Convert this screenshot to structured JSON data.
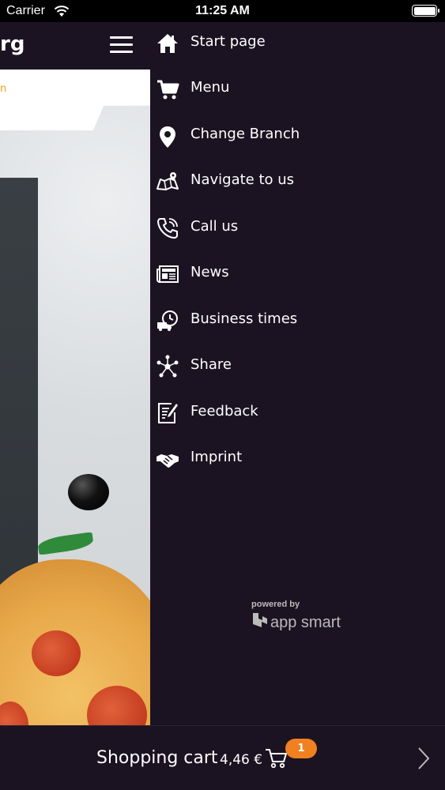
{
  "status_bar": {
    "carrier": "Carrier",
    "time": "11:25 AM"
  },
  "header": {
    "title_fragment": "rg"
  },
  "hero": {
    "tab_text_fragment": "n"
  },
  "drawer": {
    "items": [
      {
        "label": "Start page",
        "icon": "home-icon"
      },
      {
        "label": "Menu",
        "icon": "shopping-cart-icon"
      },
      {
        "label": "Change Branch",
        "icon": "map-pin-icon"
      },
      {
        "label": "Navigate to us",
        "icon": "map-icon"
      },
      {
        "label": "Call us",
        "icon": "phone-icon"
      },
      {
        "label": "News",
        "icon": "newspaper-icon"
      },
      {
        "label": "Business times",
        "icon": "delivery-clock-icon"
      },
      {
        "label": "Share",
        "icon": "share-icon"
      },
      {
        "label": "Feedback",
        "icon": "feedback-icon"
      },
      {
        "label": "Imprint",
        "icon": "handshake-icon"
      }
    ],
    "powered_by": "powered by",
    "brand": "app smart"
  },
  "cart": {
    "label": "Shopping cart",
    "price": "4,46 €",
    "badge_count": "1"
  },
  "colors": {
    "background": "#1c1322",
    "accent": "#f08020"
  }
}
